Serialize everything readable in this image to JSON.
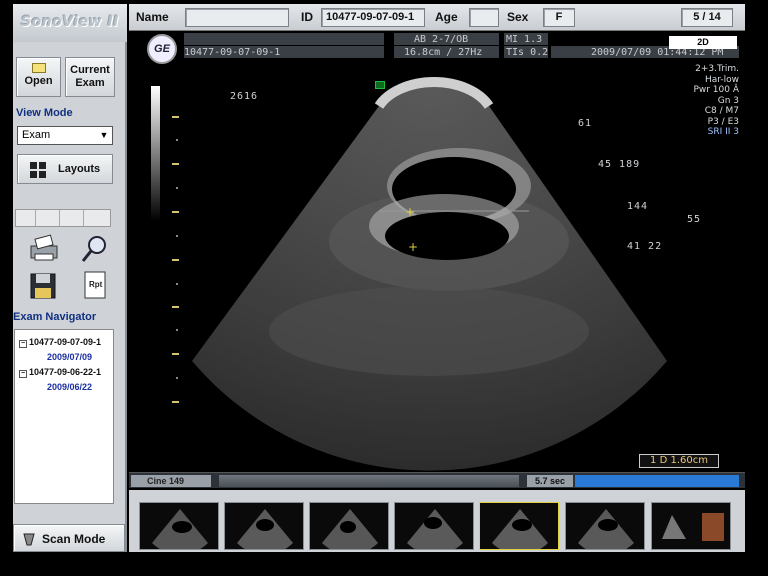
{
  "app": {
    "logo_text": "SonoView II"
  },
  "sidebar": {
    "open_label": "Open",
    "current_exam_line1": "Current",
    "current_exam_line2": "Exam",
    "view_mode_label": "View Mode",
    "view_mode_value": "Exam",
    "layouts_label": "Layouts",
    "exam_navigator_label": "Exam Navigator",
    "exams": [
      {
        "id": "10477-09-07-09-1",
        "date": "2009/07/09"
      },
      {
        "id": "10477-09-06-22-1",
        "date": "2009/06/22"
      }
    ],
    "scan_mode_label": "Scan Mode",
    "rpt_label": "Rpt"
  },
  "header": {
    "name_label": "Name",
    "name_value": "",
    "id_label": "ID",
    "id_value": "10477-09-07-09-1",
    "age_label": "Age",
    "age_value": "",
    "sex_label": "Sex",
    "sex_value": "F",
    "pager": "5 / 14"
  },
  "image": {
    "logo": "GE",
    "patient_id": "10477-09-07-09-1",
    "probe": "AB 2-7/OB",
    "depth_freq": "16.8cm / 27Hz",
    "mi": "MI  1.3",
    "tis": "TIs  0.2",
    "datetime": "2009/07/09  01:44:12 PM",
    "mode": "2D",
    "params": [
      "2+3.Trim.",
      "Har-low",
      "Pwr 100 Â",
      "Gn  3",
      "C8 / M7",
      "P3 / E3",
      "SRI II 3"
    ],
    "meas_left": "2616",
    "meas_values": [
      "61",
      "45 189",
      "144",
      "55",
      "41  22"
    ],
    "distance": "1  D 1.60cm"
  },
  "cine": {
    "label": "Cine 149",
    "seconds": "5.7 sec"
  },
  "thumbnails": {
    "count": 7,
    "selected_index": 4
  },
  "colors": {
    "panel": "#cfd3d8",
    "accent_blue": "#2a79d4",
    "caliper": "#e0d040"
  }
}
